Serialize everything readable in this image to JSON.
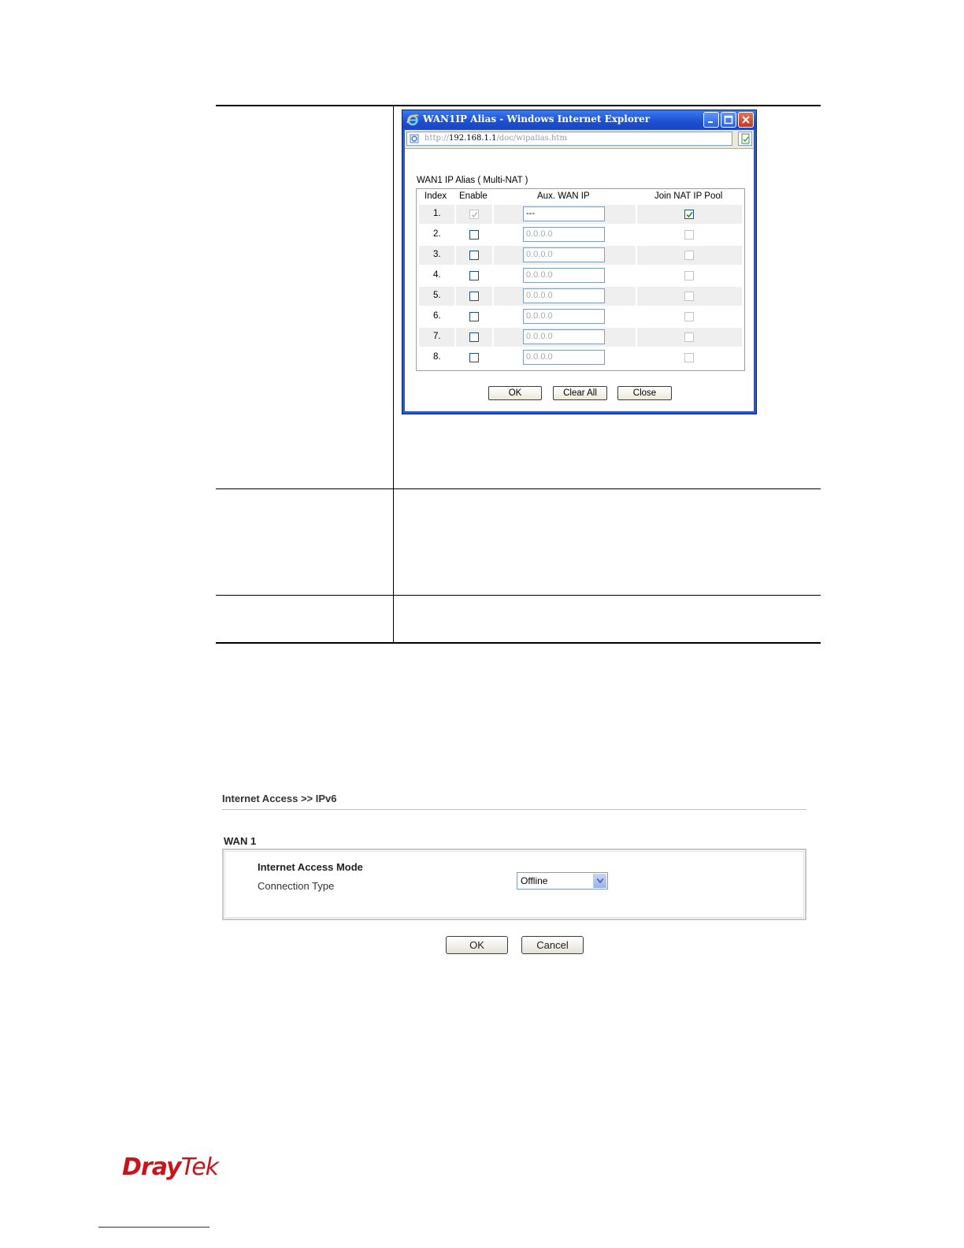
{
  "popup": {
    "window_title": "WAN1IP Alias - Windows Internet Explorer",
    "address": {
      "prefix": "http://",
      "host": "192.168.1.1",
      "path": "/doc/wipalias.htm"
    },
    "section_title": "WAN1 IP Alias ( Multi-NAT )",
    "columns": [
      "Index",
      "Enable",
      "Aux. WAN IP",
      "Join NAT IP Pool"
    ],
    "rows": [
      {
        "index": "1.",
        "enable": true,
        "enable_disabled": true,
        "ip": "---",
        "join_nat": true,
        "join_disabled": false
      },
      {
        "index": "2.",
        "enable": false,
        "enable_disabled": false,
        "ip": "0.0.0.0",
        "join_nat": false,
        "join_disabled": true
      },
      {
        "index": "3.",
        "enable": false,
        "enable_disabled": false,
        "ip": "0.0.0.0",
        "join_nat": false,
        "join_disabled": true
      },
      {
        "index": "4.",
        "enable": false,
        "enable_disabled": false,
        "ip": "0.0.0.0",
        "join_nat": false,
        "join_disabled": true
      },
      {
        "index": "5.",
        "enable": false,
        "enable_disabled": false,
        "ip": "0.0.0.0",
        "join_nat": false,
        "join_disabled": true
      },
      {
        "index": "6.",
        "enable": false,
        "enable_disabled": false,
        "ip": "0.0.0.0",
        "join_nat": false,
        "join_disabled": true
      },
      {
        "index": "7.",
        "enable": false,
        "enable_disabled": false,
        "ip": "0.0.0.0",
        "join_nat": false,
        "join_disabled": true
      },
      {
        "index": "8.",
        "enable": false,
        "enable_disabled": false,
        "ip": "0.0.0.0",
        "join_nat": false,
        "join_disabled": true
      }
    ],
    "buttons": {
      "ok": "OK",
      "clear_all": "Clear All",
      "close": "Close"
    }
  },
  "ipv6": {
    "breadcrumb": "Internet Access >> IPv6",
    "wan_heading": "WAN 1",
    "mode_heading": "Internet Access Mode",
    "connection_type_label": "Connection Type",
    "connection_type_value": "Offline",
    "buttons": {
      "ok": "OK",
      "cancel": "Cancel"
    }
  },
  "footer": {
    "logo_part1": "Dray",
    "logo_part2": "Tek",
    "brand_color": "#c8151d"
  }
}
